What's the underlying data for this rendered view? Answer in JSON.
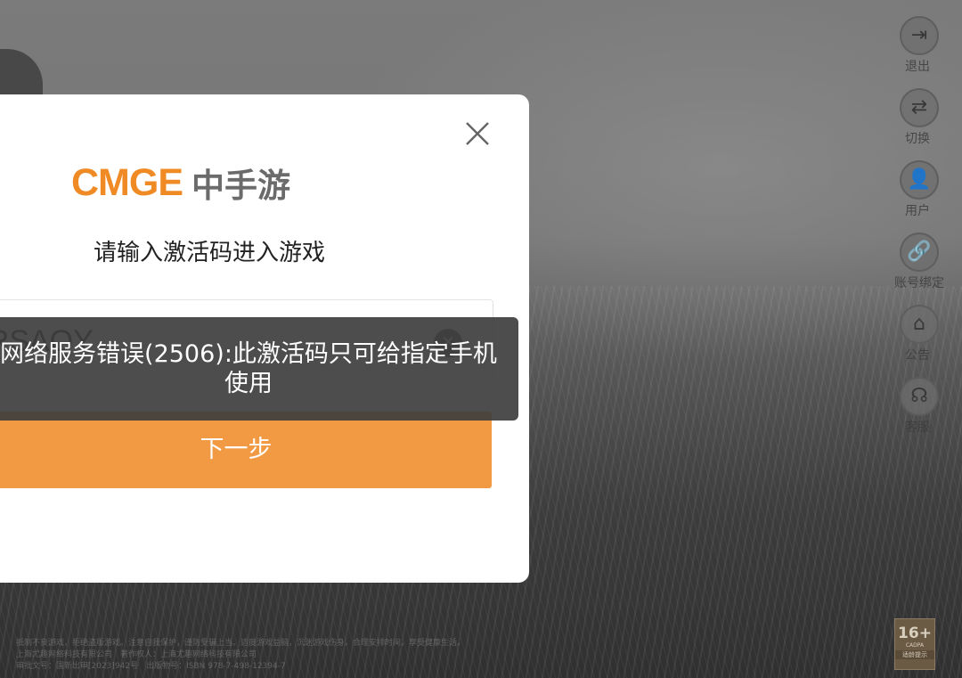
{
  "side_menu": {
    "items": [
      {
        "label": "退出",
        "icon": "exit-icon",
        "glyph": "⇥"
      },
      {
        "label": "切换",
        "icon": "switch-icon",
        "glyph": "⇄"
      },
      {
        "label": "用户",
        "icon": "user-icon",
        "glyph": "👤"
      },
      {
        "label": "账号绑定",
        "icon": "link-icon",
        "glyph": "🔗"
      },
      {
        "label": "公告",
        "icon": "announcement-icon",
        "glyph": "⌂"
      },
      {
        "label": "客服",
        "icon": "headset-icon",
        "glyph": "☊"
      }
    ]
  },
  "dialog": {
    "logo_en": "CMGE",
    "logo_cn": "中手游",
    "prompt": "请输入激活码进入游戏",
    "code_value": "TRSAQY",
    "next_label": "下一步"
  },
  "toast": {
    "message": "网络服务错误(2506):此激活码只可给指定手机使用"
  },
  "age_badge": {
    "age": "16+",
    "org": "CADPA",
    "tip": "适龄提示"
  },
  "colors": {
    "brand_orange": "#f08a24",
    "button_orange": "#f19a43",
    "toast_bg": "#3e3e3e"
  }
}
